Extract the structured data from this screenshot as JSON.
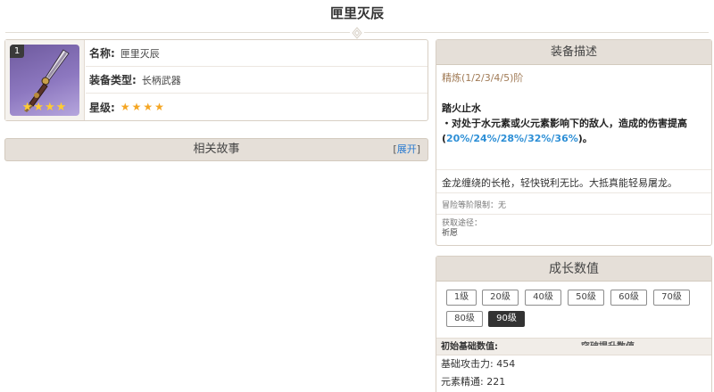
{
  "page": {
    "title": "匣里灭辰"
  },
  "weapon": {
    "refine_badge": "1",
    "thumb_stars": "★★★★",
    "name_label": "名称:",
    "name_value": "匣里灭辰",
    "type_label": "装备类型:",
    "type_value": "长柄武器",
    "rarity_label": "星级:",
    "rarity_stars": "★★★★"
  },
  "story": {
    "title": "相关故事",
    "bracket_open": "[",
    "toggle_label": "展开",
    "bracket_close": "]"
  },
  "description": {
    "header": "装备描述",
    "refine_line": "精炼(1/2/3/4/5)阶",
    "skill_name": "踏火止水",
    "skill_text": "・对处于水元素或火元素影响下的敌人，造成的伤害提高(",
    "skill_values": "20%/24%/28%/32%/36%",
    "skill_end": ")。",
    "flavor": "金龙缠绕的长枪，轻快锐利无比。大抵真能轻易屠龙。",
    "ascension_label": "冒险等阶限制：无",
    "obtain_label": "获取途径：",
    "obtain_value": "祈愿"
  },
  "growth": {
    "header": "成长数值",
    "levels": [
      "1级",
      "20级",
      "40级",
      "50级",
      "60级",
      "70级",
      "80级",
      "90级"
    ],
    "active_level": "90级",
    "base_header": "初始基础数值:",
    "secondary_header": "突破提升数值",
    "stats": [
      {
        "label": "基础攻击力: 454"
      },
      {
        "label": "元素精通: 221"
      }
    ]
  },
  "colors": {
    "accent_blue": "#2d8fd6",
    "refine_text": "#a07a55",
    "header_bg": "#e5dfd8",
    "star_gold": "#f5a623"
  }
}
